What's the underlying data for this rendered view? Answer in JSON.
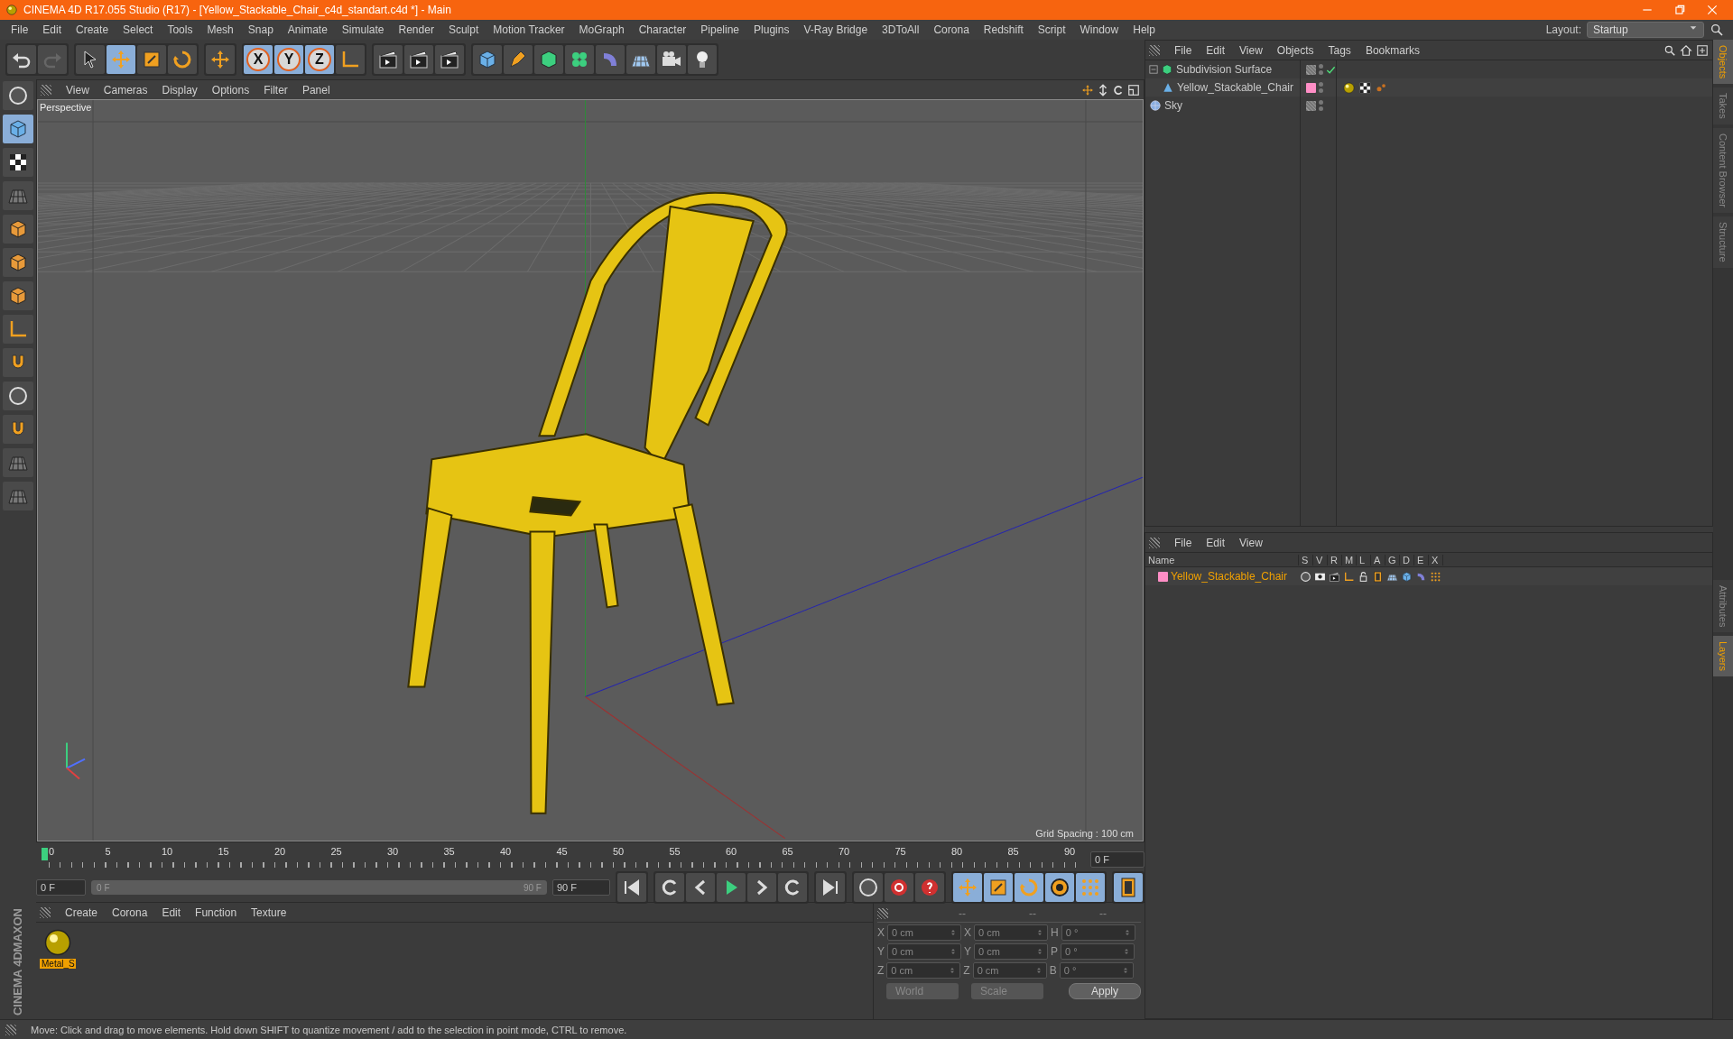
{
  "window": {
    "title": "CINEMA 4D R17.055 Studio (R17) - [Yellow_Stackable_Chair_c4d_standart.c4d *] - Main"
  },
  "menu": [
    "File",
    "Edit",
    "Create",
    "Select",
    "Tools",
    "Mesh",
    "Snap",
    "Animate",
    "Simulate",
    "Render",
    "Sculpt",
    "Motion Tracker",
    "MoGraph",
    "Character",
    "Pipeline",
    "Plugins",
    "V-Ray Bridge",
    "3DToAll",
    "Corona",
    "Redshift",
    "Script",
    "Window",
    "Help"
  ],
  "layout": {
    "label": "Layout:",
    "value": "Startup"
  },
  "axis_locks": [
    {
      "label": "X",
      "on": true
    },
    {
      "label": "Y",
      "on": true
    },
    {
      "label": "Z",
      "on": true
    }
  ],
  "viewport": {
    "menu": [
      "View",
      "Cameras",
      "Display",
      "Options",
      "Filter",
      "Panel"
    ],
    "camera": "Perspective",
    "grid_spacing": "Grid Spacing : 100 cm"
  },
  "timeline": {
    "ticks": [
      "0",
      "5",
      "10",
      "15",
      "20",
      "25",
      "30",
      "35",
      "40",
      "45",
      "50",
      "55",
      "60",
      "65",
      "70",
      "75",
      "80",
      "85",
      "90"
    ],
    "current": "0 F",
    "start": "0 F",
    "range_start": "0 F",
    "range_end": "90 F",
    "level": 1,
    "end": "90 F"
  },
  "material_manager": {
    "menu": [
      "Create",
      "Corona",
      "Edit",
      "Function",
      "Texture"
    ],
    "materials": [
      {
        "name": "Metal_S",
        "selected": true
      }
    ]
  },
  "coordinates": {
    "headers": [
      "--",
      "--",
      "--"
    ],
    "rows": [
      {
        "axis": "X",
        "position": "0 cm",
        "size_axis": "X",
        "size": "0 cm",
        "rot_axis": "H",
        "rotation": "0 °"
      },
      {
        "axis": "Y",
        "position": "0 cm",
        "size_axis": "Y",
        "size": "0 cm",
        "rot_axis": "P",
        "rotation": "0 °"
      },
      {
        "axis": "Z",
        "position": "0 cm",
        "size_axis": "Z",
        "size": "0 cm",
        "rot_axis": "B",
        "rotation": "0 °"
      }
    ],
    "mode": "World",
    "size_mode": "Scale",
    "apply": "Apply"
  },
  "object_manager": {
    "menu": [
      "File",
      "Edit",
      "View",
      "Objects",
      "Tags",
      "Bookmarks"
    ],
    "objects": [
      {
        "name": "Subdivision Surface",
        "kind": "generator",
        "checked": true,
        "children": [
          {
            "name": "Yellow_Stackable_Chair",
            "kind": "polygon",
            "checked": false,
            "color": "#ff8ec6",
            "tags": [
              {
                "kind": "material"
              },
              {
                "kind": "checker"
              },
              {
                "kind": "dots"
              }
            ]
          }
        ]
      },
      {
        "name": "Sky",
        "kind": "sky",
        "checked": false
      }
    ]
  },
  "layer_manager": {
    "menu": [
      "File",
      "Edit",
      "View"
    ],
    "columns": [
      "Name",
      "S",
      "V",
      "R",
      "M",
      "L",
      "A",
      "G",
      "D",
      "E",
      "X"
    ],
    "layers": [
      {
        "name": "Yellow_Stackable_Chair",
        "color": "#ff8ec6"
      }
    ]
  },
  "side_tabs": [
    {
      "label": "Objects",
      "selected": true
    },
    {
      "label": "Takes",
      "selected": false
    },
    {
      "label": "Content Browser",
      "selected": false
    },
    {
      "label": "Structure",
      "selected": false
    }
  ],
  "side_tabs_lower": [
    {
      "label": "Attributes",
      "selected": false
    },
    {
      "label": "Layers",
      "selected": true
    }
  ],
  "brand": [
    "MAXON",
    "CINEMA 4D"
  ],
  "status_bar": "Move: Click and drag to move elements. Hold down SHIFT to quantize movement / add to the selection in point mode, CTRL to remove."
}
